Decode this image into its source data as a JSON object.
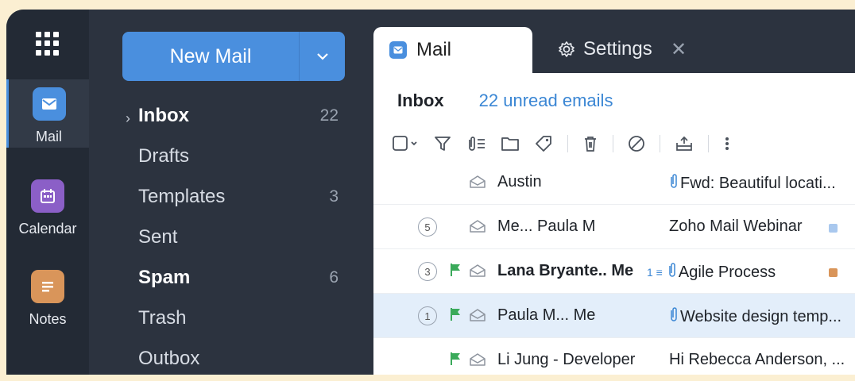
{
  "rail": {
    "items": [
      {
        "label": "Mail",
        "color": "#4a8fde",
        "icon": "mail-icon",
        "active": true
      },
      {
        "label": "Calendar",
        "color": "#8b5fc7",
        "icon": "calendar-icon"
      },
      {
        "label": "Notes",
        "color": "#d9955a",
        "icon": "notes-icon"
      }
    ]
  },
  "compose": {
    "label": "New Mail"
  },
  "folders": [
    {
      "name": "Inbox",
      "count": "22",
      "bold": true
    },
    {
      "name": "Drafts",
      "count": ""
    },
    {
      "name": "Templates",
      "count": "3"
    },
    {
      "name": "Sent",
      "count": ""
    },
    {
      "name": "Spam",
      "count": "6",
      "bold": true
    },
    {
      "name": "Trash",
      "count": ""
    },
    {
      "name": "Outbox",
      "count": ""
    }
  ],
  "tabs": {
    "mail": "Mail",
    "settings": "Settings"
  },
  "inbox": {
    "title": "Inbox",
    "unread": "22 unread emails"
  },
  "emails": [
    {
      "thread": "",
      "flag": false,
      "from": "Austin",
      "subject": "Fwd: Beautiful locati...",
      "attachment": true,
      "count": "",
      "label_color": ""
    },
    {
      "thread": "5",
      "flag": false,
      "from": "Me... Paula M",
      "subject": "Zoho Mail Webinar",
      "attachment": false,
      "count": "",
      "label_color": "#a9c8ee"
    },
    {
      "thread": "3",
      "flag": true,
      "from": "Lana Bryante.. Me",
      "subject": "Agile Process",
      "attachment": true,
      "count": "1",
      "label_color": "#d9955a",
      "unread": true
    },
    {
      "thread": "1",
      "flag": true,
      "from": "Paula M... Me",
      "subject": "Website design temp...",
      "attachment": true,
      "count": "",
      "label_color": "",
      "selected": true
    },
    {
      "thread": "",
      "flag": true,
      "from": "Li Jung - Developer",
      "subject": "Hi Rebecca Anderson, ...",
      "attachment": false,
      "count": "",
      "label_color": ""
    }
  ]
}
